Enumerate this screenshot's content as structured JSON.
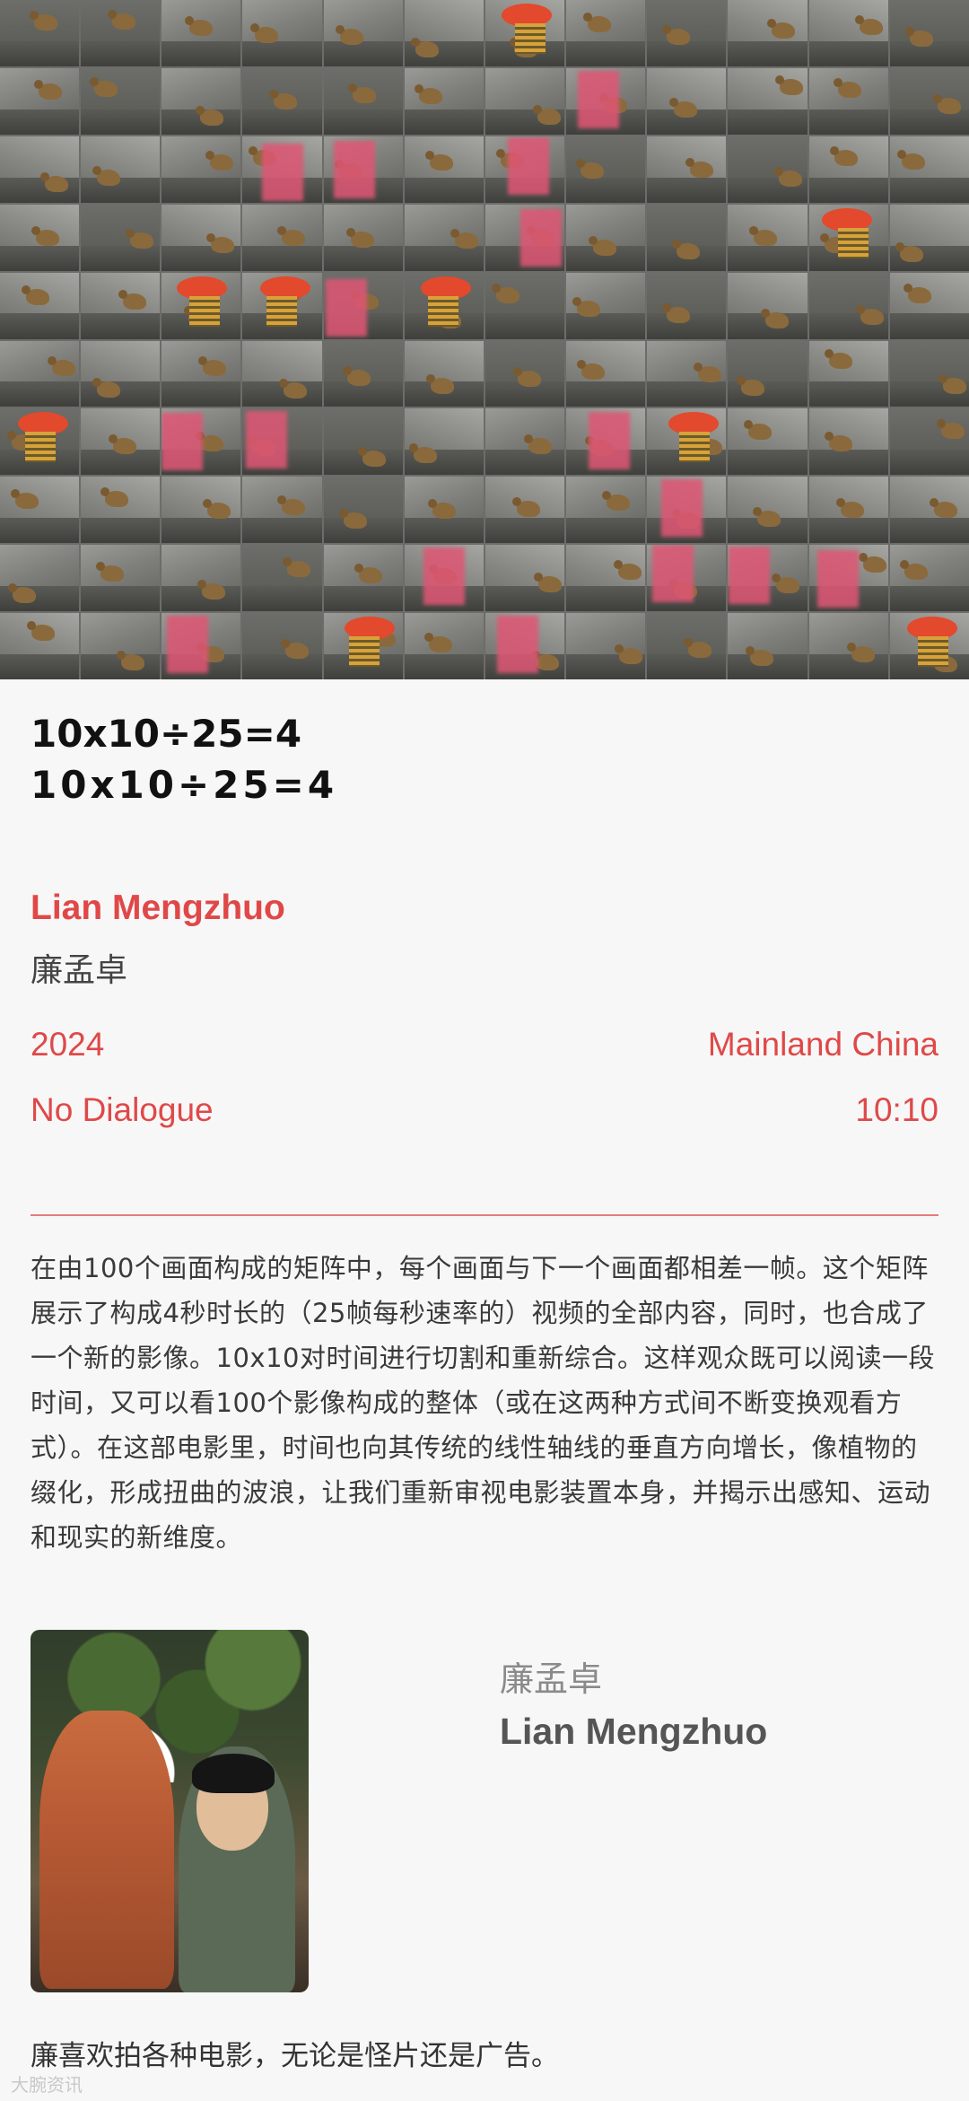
{
  "film": {
    "title": "10x10÷25=4",
    "title_spaced": "10x10÷25=4",
    "director_en": "Lian Mengzhuo",
    "director_cn": "廉孟卓",
    "year": "2024",
    "country": "Mainland China",
    "language": "No Dialogue",
    "duration": "10:10"
  },
  "synopsis": "在由100个画面构成的矩阵中，每个画面与下一个画面都相差一帧。这个矩阵展示了构成4秒时长的（25帧每秒速率的）视频的全部内容，同时，也合成了一个新的影像。10x10对时间进行切割和重新综合。这样观众既可以阅读一段时间，又可以看100个影像构成的整体（或在这两种方式间不断变换观看方式）。在这部电影里，时间也向其传统的线性轴线的垂直方向增长，像植物的缀化，形成扭曲的波浪，让我们重新审视电影装置本身，并揭示出感知、运动和现实的新维度。",
  "profile": {
    "name_cn": "廉孟卓",
    "name_en": "Lian Mengzhuo",
    "bio": "廉喜欢拍各种电影，无论是怪片还是广告。"
  },
  "watermark": "大腕资讯",
  "colors": {
    "accent": "#e04848",
    "divider": "#e67a7a",
    "background": "#f7f7f7"
  }
}
